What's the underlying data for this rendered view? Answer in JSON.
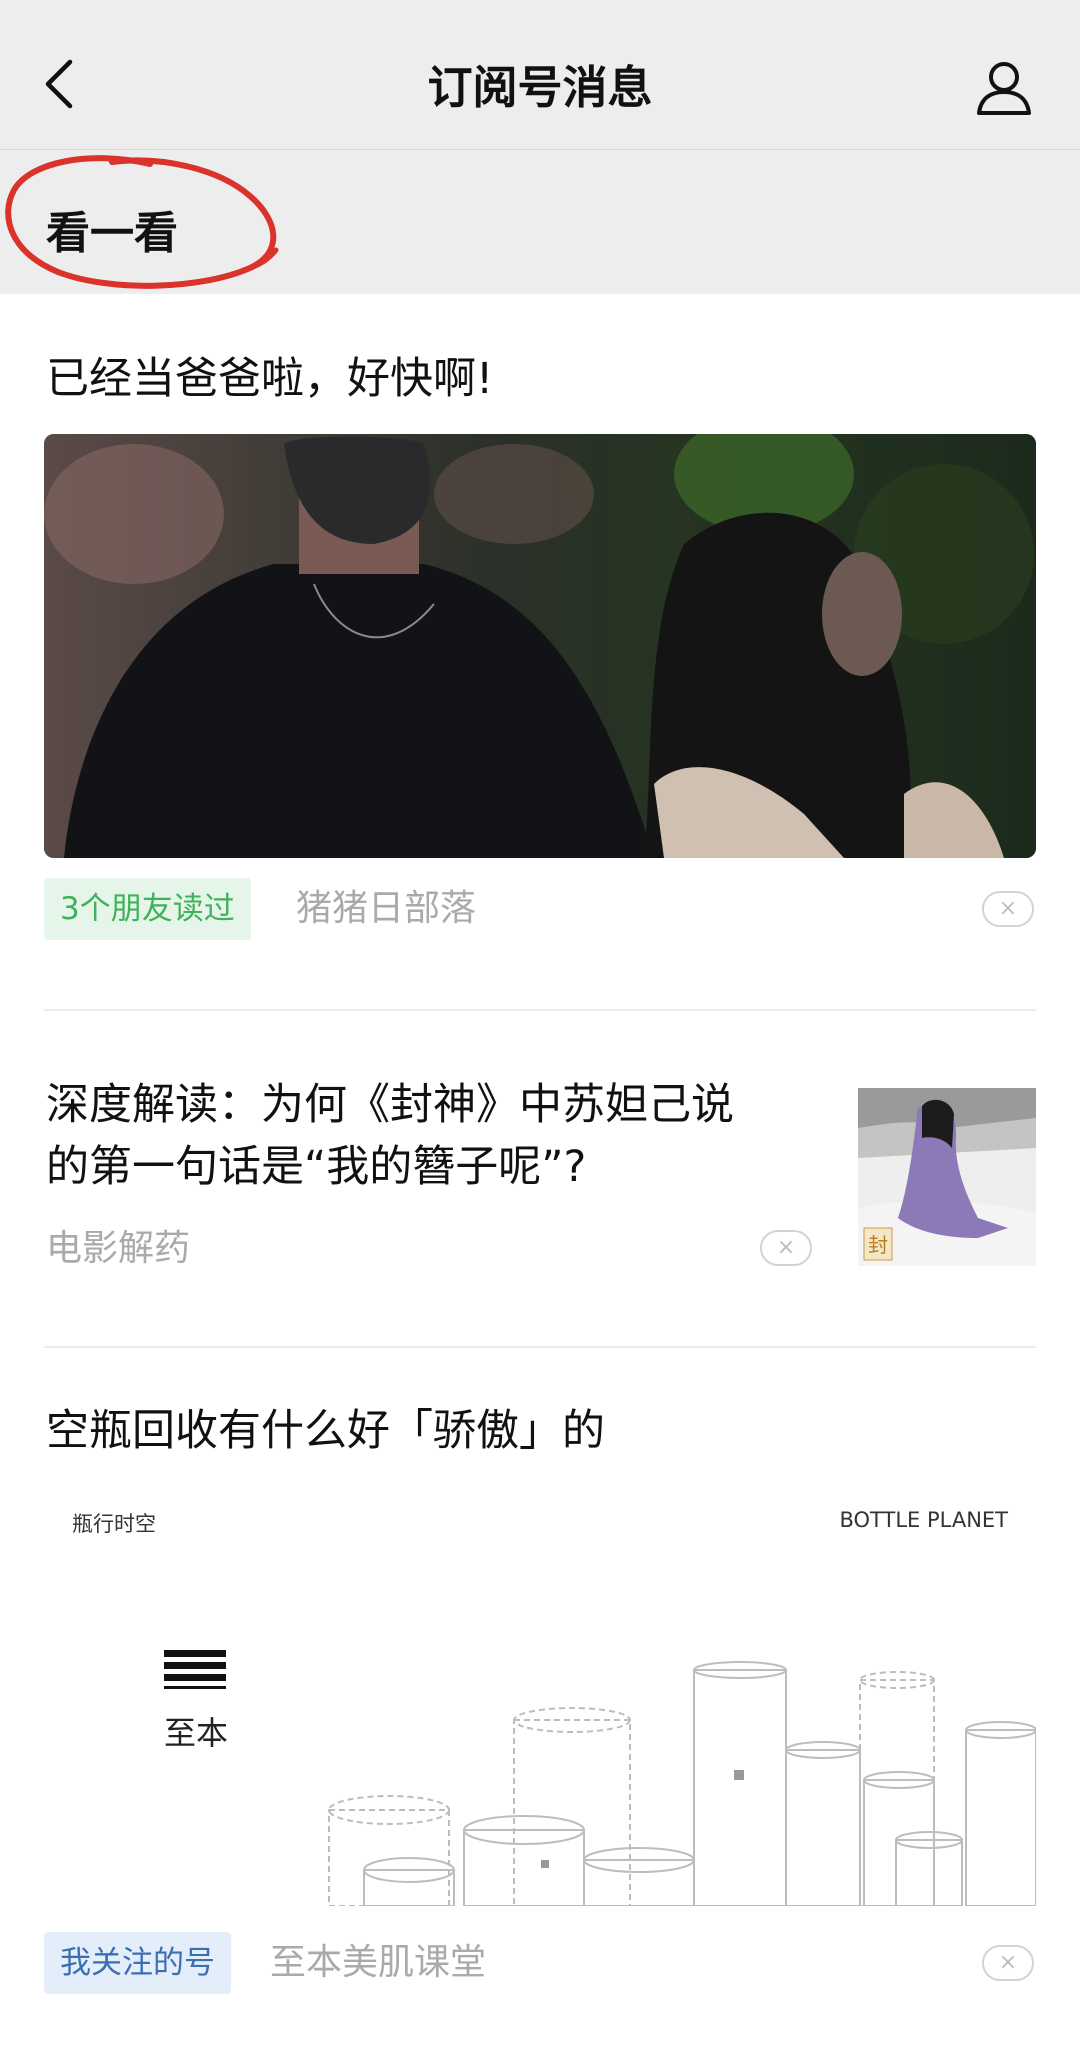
{
  "nav": {
    "title": "订阅号消息",
    "back_icon": "chevron-left-icon",
    "profile_icon": "person-icon"
  },
  "section": {
    "title": "看一看",
    "highlight_color": "#d9332b"
  },
  "articles": [
    {
      "title": "已经当爸爸啦，好快啊!",
      "tag": "3个朋友读过",
      "source": "猪猪日部落",
      "close_label": "×"
    },
    {
      "title_line1": "深度解读：为何《封神》中苏妲己说",
      "title_line2": "的第一句话是“我的簪子呢”?",
      "source": "电影解药",
      "close_label": "×",
      "thumb_mark": "封"
    },
    {
      "title": "空瓶回收有什么好「骄傲」的",
      "image_left_label": "瓶行时空",
      "image_right_label": "BOTTLE PLANET",
      "brand": "至本",
      "tag": "我关注的号",
      "source": "至本美肌课堂",
      "close_label": "×"
    }
  ],
  "colors": {
    "header_bg": "#ededed",
    "tag_green_bg": "#e6f5e9",
    "tag_green_text": "#3fb35a",
    "tag_blue_bg": "#e4eefa",
    "tag_blue_text": "#3c6fb0",
    "source_text": "#aaaaaa"
  }
}
